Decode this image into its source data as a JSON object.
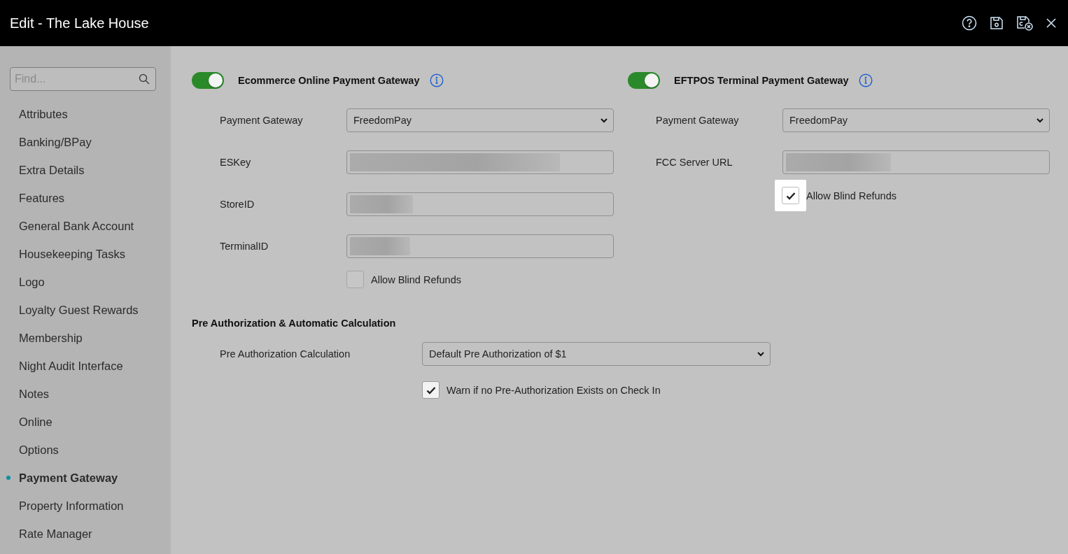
{
  "window": {
    "title": "Edit - The Lake House"
  },
  "toolbar": [
    {
      "kind": "help"
    },
    {
      "kind": "save"
    },
    {
      "kind": "save-close"
    },
    {
      "kind": "close"
    }
  ],
  "sidebar": {
    "search": {
      "placeholder": "Find..."
    },
    "items": [
      {
        "label": "Attributes",
        "selected": false
      },
      {
        "label": "Banking/BPay",
        "selected": false
      },
      {
        "label": "Extra Details",
        "selected": false
      },
      {
        "label": "Features",
        "selected": false
      },
      {
        "label": "General Bank Account",
        "selected": false
      },
      {
        "label": "Housekeeping Tasks",
        "selected": false
      },
      {
        "label": "Logo",
        "selected": false
      },
      {
        "label": "Loyalty Guest Rewards",
        "selected": false
      },
      {
        "label": "Membership",
        "selected": false
      },
      {
        "label": "Night Audit Interface",
        "selected": false
      },
      {
        "label": "Notes",
        "selected": false
      },
      {
        "label": "Online",
        "selected": false
      },
      {
        "label": "Options",
        "selected": false
      },
      {
        "label": "Payment Gateway",
        "selected": true
      },
      {
        "label": "Property Information",
        "selected": false
      },
      {
        "label": "Rate Manager",
        "selected": false
      }
    ]
  },
  "gateways": [
    {
      "title": "Ecommerce Online Payment Gateway",
      "on": true,
      "fields": [
        {
          "kind": "select",
          "label": "Payment Gateway",
          "value": "FreedomPay"
        },
        {
          "kind": "redacted",
          "label": "ESKey"
        },
        {
          "kind": "redacted",
          "label": "StoreID"
        },
        {
          "kind": "redacted",
          "label": "TerminalID"
        }
      ],
      "checkbox": {
        "label": "Allow Blind Refunds",
        "checked": false,
        "highlighted": false
      }
    },
    {
      "title": "EFTPOS Terminal Payment Gateway",
      "on": true,
      "fields": [
        {
          "kind": "select",
          "label": "Payment Gateway",
          "value": "FreedomPay"
        },
        {
          "kind": "redacted",
          "label": "FCC Server URL"
        }
      ],
      "checkbox": {
        "label": "Allow Blind Refunds",
        "checked": true,
        "highlighted": true
      }
    }
  ],
  "preauth": {
    "heading": "Pre Authorization & Automatic Calculation",
    "label": "Pre Authorization Calculation",
    "value": "Default Pre Authorization of $1",
    "checkbox": {
      "label": "Warn if no Pre-Authorization Exists on Check In",
      "checked": true,
      "highlighted": false
    }
  }
}
